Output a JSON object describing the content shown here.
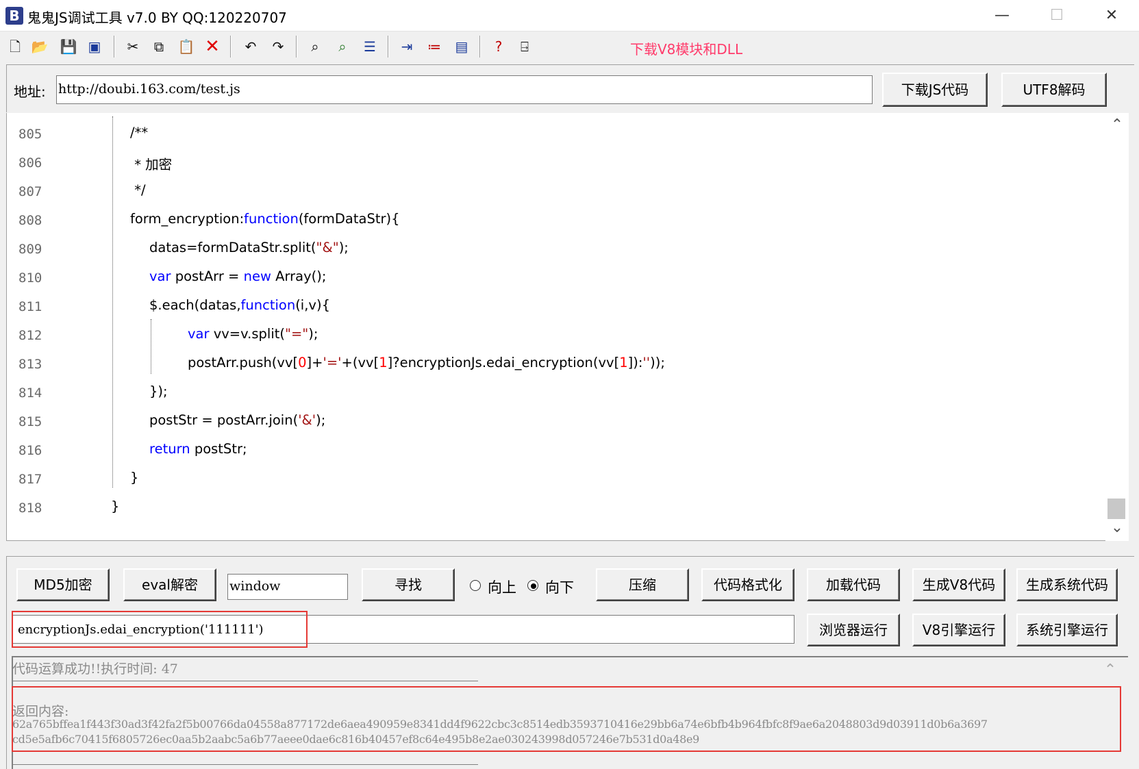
{
  "window": {
    "app_icon_letter": "B",
    "title": "鬼鬼JS调试工具 v7.0 BY QQ:120220707",
    "minimize": "—",
    "maximize": "☐",
    "close": "✕"
  },
  "toolbar": {
    "icons": [
      "new-file",
      "open-folder",
      "save",
      "save-all",
      "cut",
      "copy",
      "paste",
      "delete",
      "undo",
      "redo",
      "find",
      "find-next",
      "list",
      "indent",
      "numbered-list",
      "window",
      "help-pointer",
      "exit"
    ],
    "link": "下载V8模块和DLL"
  },
  "address": {
    "label": "地址:",
    "value": "http://doubi.163.com/test.js",
    "download_button": "下载JS代码",
    "utf8_button": "UTF8解码"
  },
  "editor": {
    "lines": [
      {
        "no": "805"
      },
      {
        "no": "806"
      },
      {
        "no": "807"
      },
      {
        "no": "808"
      },
      {
        "no": "809"
      },
      {
        "no": "810"
      },
      {
        "no": "811"
      },
      {
        "no": "812"
      },
      {
        "no": "813"
      },
      {
        "no": "814"
      },
      {
        "no": "815"
      },
      {
        "no": "816"
      },
      {
        "no": "817"
      },
      {
        "no": "818"
      }
    ],
    "code": {
      "l805": "/**",
      "l806": " * 加密",
      "l807": " */",
      "l808_a": "form_encryption:",
      "l808_kw": "function",
      "l808_b": "(formDataStr){",
      "l809_a": "datas=formDataStr.split(",
      "l809_s": "\"&\"",
      "l809_b": ");",
      "l810_kw1": "var",
      "l810_a": " postArr = ",
      "l810_kw2": "new",
      "l810_b": " Array();",
      "l811_a": "$.each(datas,",
      "l811_kw": "function",
      "l811_b": "(i,v){",
      "l812_kw": "var",
      "l812_a": " vv=v.split(",
      "l812_s": "\"=\"",
      "l812_b": ");",
      "l813_a": "postArr.push(vv[",
      "l813_n1": "0",
      "l813_b": "]+",
      "l813_s1": "'='",
      "l813_c": "+(vv[",
      "l813_n2": "1",
      "l813_d": "]?encryptionJs.edai_encryption(vv[",
      "l813_n3": "1",
      "l813_e": "]):",
      "l813_s2": "''",
      "l813_f": "));",
      "l814": "});",
      "l815_a": "postStr = postArr.join(",
      "l815_s": "'&'",
      "l815_b": ");",
      "l816_kw": "return",
      "l816_a": " postStr;",
      "l817": "}",
      "l818": "}"
    }
  },
  "controls": {
    "md5_button": "MD5加密",
    "eval_button": "eval解密",
    "search_value": "window",
    "find_button": "寻找",
    "radio_up": "向上",
    "radio_down": "向下",
    "compress_button": "压缩",
    "format_button": "代码格式化",
    "load_button": "加载代码",
    "gen_v8_button": "生成V8代码",
    "gen_sys_button": "生成系统代码",
    "command_value": "encryptionJs.edai_encryption('111111')",
    "browser_run_button": "浏览器运行",
    "v8_run_button": "V8引擎运行",
    "sys_run_button": "系统引擎运行"
  },
  "output": {
    "status": "代码运算成功!!执行时间: 47",
    "return_label": "返回内容:",
    "return_line1": "62a765bffea1f443f30ad3f42fa2f5b00766da04558a877172de6aea490959e8341dd4f9622cbc3c8514edb3593710416e29bb6a74e6bfb4b964fbfc8f9ae6a2048803d9d03911d0b6a3697",
    "return_line2": "cd5e5afb6c70415f6805726ec0aa5b2aabc5a6b77aeee0dae6c816b40457ef8c64e495b8e2ae030243998d057246e7b531d0a48e9"
  },
  "colors": {
    "keyword": "#0000ff",
    "string": "#a31515",
    "number": "#ff0000",
    "link": "#ff3b6b",
    "highlight_box": "#e53935"
  }
}
